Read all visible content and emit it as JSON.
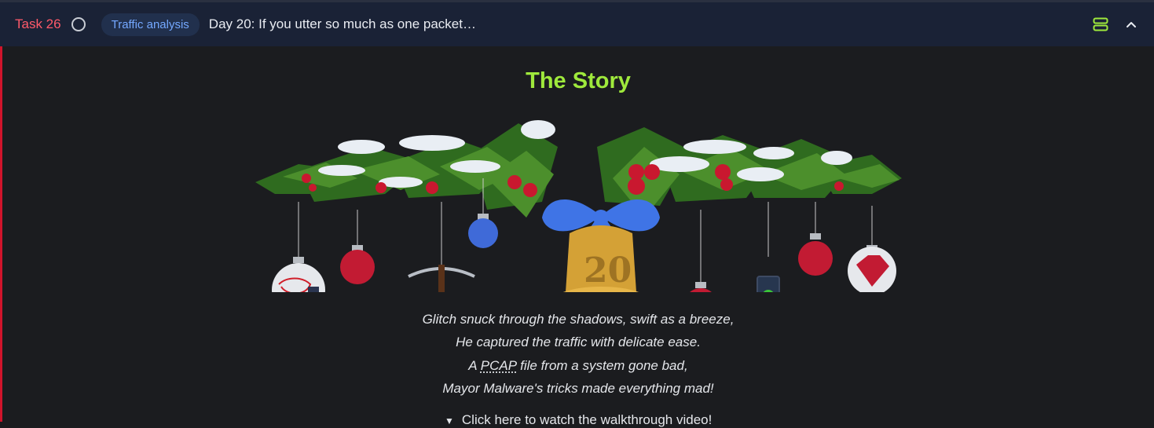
{
  "header": {
    "task_label": "Task 26",
    "tag": "Traffic analysis",
    "title": "Day 20: If you utter so much as one packet…"
  },
  "story": {
    "heading": "The Story",
    "poem_lines": [
      "Glitch snuck through the shadows, swift as a breeze,",
      "He captured the traffic with delicate ease.",
      "A ",
      "PCAP",
      " file from a system gone bad,",
      "Mayor Malware's tricks made everything mad!"
    ],
    "walkthrough_label": "Click here to watch the walkthrough video!",
    "bell_number": "20"
  },
  "colors": {
    "accent_red": "#d0142b",
    "heading_green": "#9fe93c",
    "tag_blue": "#74a8ff"
  }
}
